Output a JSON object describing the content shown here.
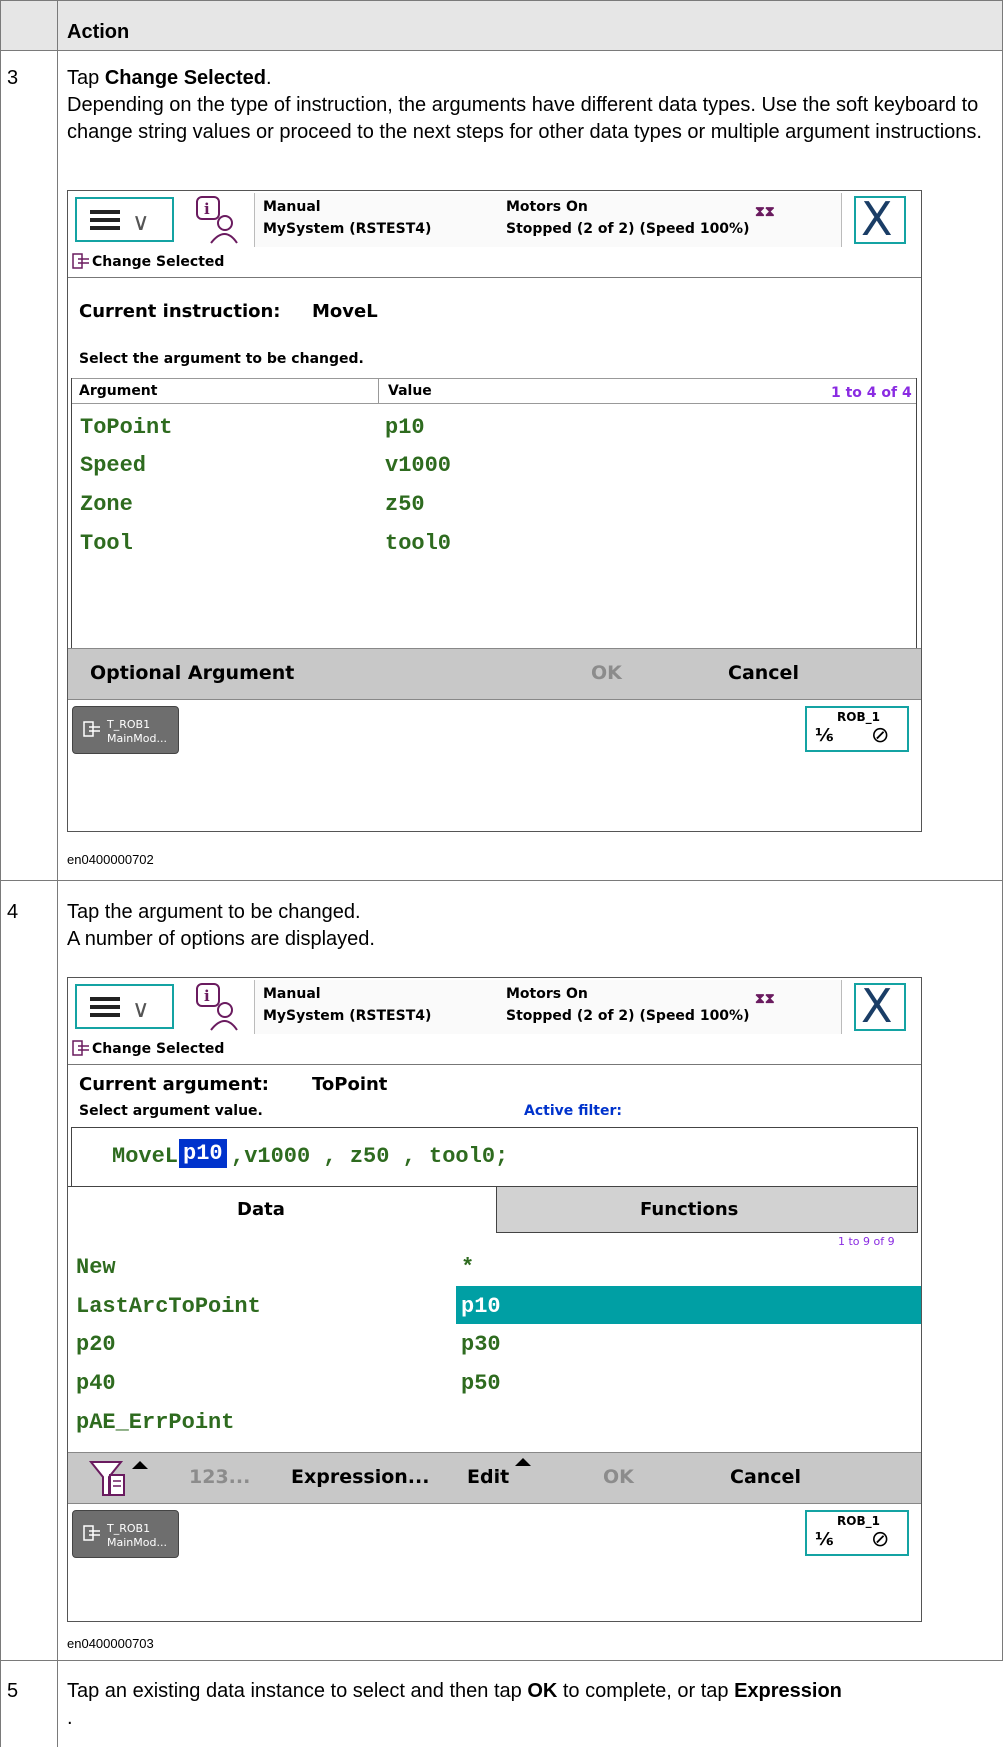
{
  "table": {
    "header": "Action",
    "steps": [
      {
        "number": "3",
        "instruction_prefix": "Tap ",
        "instruction_bold": "Change Selected",
        "instruction_suffix": ".",
        "description": "Depending on the type of instruction, the arguments have different data types. Use the soft keyboard to change string values or proceed to the next steps for other data types or multiple argument instructions.",
        "caption": "en0400000702"
      },
      {
        "number": "4",
        "line1": "Tap the argument to be changed.",
        "line2": "A number of options are displayed.",
        "caption": "en0400000703"
      },
      {
        "number": "5",
        "text_part1": "Tap an existing data instance to select and then tap ",
        "text_bold1": "OK",
        "text_part2": " to complete, or tap ",
        "text_bold2": "Expression",
        "text_part3": "."
      }
    ]
  },
  "status": {
    "mode": "Manual",
    "system": "MySystem (RSTEST4)",
    "motors": "Motors On",
    "state": "Stopped (2 of 2) (Speed 100%)",
    "close": "X"
  },
  "screen1": {
    "tab": "Change Selected",
    "current_instruction_label": "Current instruction:",
    "current_instruction_value": "MoveL",
    "prompt": "Select the argument to be changed.",
    "col_argument": "Argument",
    "col_value": "Value",
    "count": "1 to 4 of 4",
    "rows": [
      {
        "argument": "ToPoint",
        "value": "p10"
      },
      {
        "argument": "Speed",
        "value": "v1000"
      },
      {
        "argument": "Zone",
        "value": "z50"
      },
      {
        "argument": "Tool",
        "value": "tool0"
      }
    ],
    "cmd_optional": "Optional Argument",
    "cmd_ok": "OK",
    "cmd_cancel": "Cancel"
  },
  "screen2": {
    "tab": "Change Selected",
    "current_argument_label": "Current argument:",
    "current_argument_value": "ToPoint",
    "prompt": "Select argument value.",
    "active_filter": "Active filter:",
    "instr_keyword": "MoveL",
    "instr_selected": "p10",
    "instr_rest": ",v1000 , z50 , tool0;",
    "tab_data": "Data",
    "tab_functions": "Functions",
    "count": "1 to 9 of 9",
    "items_left": [
      "New",
      "LastArcToPoint",
      "p20",
      "p40",
      "pAE_ErrPoint"
    ],
    "items_right": [
      "*",
      "p10",
      "p30",
      "p50"
    ],
    "cmd_123": "123...",
    "cmd_expression": "Expression...",
    "cmd_edit": "Edit",
    "cmd_ok": "OK",
    "cmd_cancel": "Cancel"
  },
  "taskbar": {
    "task_line1": "T_ROB1",
    "task_line2": "MainMod...",
    "robot": "ROB_1",
    "fraction": "⅙"
  },
  "colors": {
    "accent": "#14a3a3",
    "selected_row": "#009fa4",
    "code_green": "#2e6b1f",
    "highlight_blue": "#0033cc"
  }
}
